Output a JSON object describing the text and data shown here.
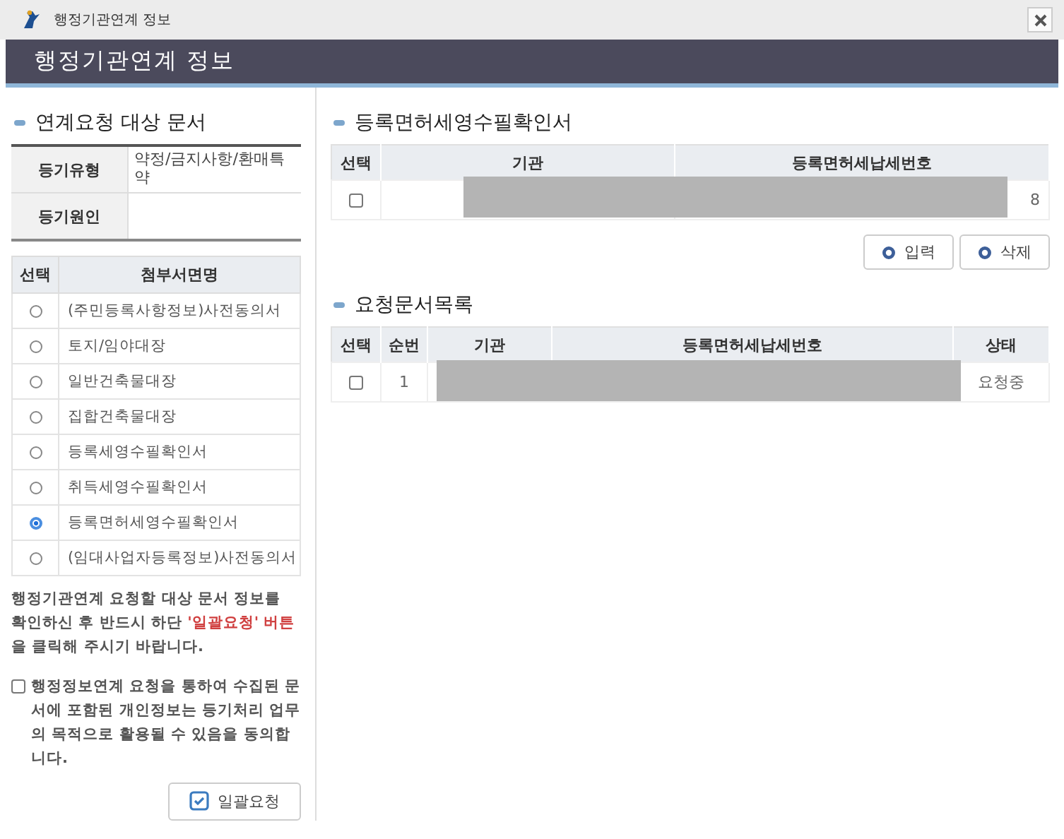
{
  "window": {
    "title": "행정기관연계 정보"
  },
  "header": {
    "title": "행정기관연계 정보"
  },
  "left": {
    "title": "연계요청 대상 문서",
    "info": [
      {
        "label": "등기유형",
        "value": "약정/금지사항/환매특약"
      },
      {
        "label": "등기원인"
      }
    ],
    "documents": {
      "columns": [
        "선택",
        "첨부서면명"
      ],
      "rows": [
        {
          "name": "(주민등록사항정보)사전동의서",
          "selected": false
        },
        {
          "name": "토지/임야대장",
          "selected": false
        },
        {
          "name": "일반건축물대장",
          "selected": false
        },
        {
          "name": "집합건축물대장",
          "selected": false
        },
        {
          "name": "등록세영수필확인서",
          "selected": false
        },
        {
          "name": "취득세영수필확인서",
          "selected": false
        },
        {
          "name": "등록면허세영수필확인서",
          "selected": true
        },
        {
          "name": "(임대사업자등록정보)사전동의서",
          "selected": false
        }
      ]
    },
    "note": [
      {
        "text": "행정기관연계 요청할 대상 문서 정보를 확인하신 후 반드시 하단 ",
        "kind": "plain"
      },
      {
        "text": "'일괄요청' 버튼",
        "kind": "emphasis"
      },
      {
        "text": "을 클릭해 주시기 바랍니다.",
        "kind": "plain"
      }
    ],
    "consent": {
      "text": "행정정보연계 요청을 통하여 수집된 문서에 포함된 개인정보는 등기처리 업무의 목적으로 활용될 수 있음을 동의합니다.",
      "checked": false
    },
    "button": "일괄요청"
  },
  "receipt": {
    "title": "등록면허세영수필확인서",
    "columns": [
      "선택",
      "기관",
      "등록면허세납세번호"
    ],
    "rows": [
      {
        "checked": false,
        "cells": [
          "",
          "",
          "8"
        ]
      }
    ],
    "buttons": [
      "입력",
      "삭제"
    ]
  },
  "requests": {
    "title": "요청문서목록",
    "columns": [
      "선택",
      "순번",
      "기관",
      "등록면허세납세번호",
      "상태"
    ],
    "rows": [
      {
        "checked": false,
        "cells": [
          "",
          "1",
          "",
          "",
          "요청중"
        ]
      }
    ]
  }
}
